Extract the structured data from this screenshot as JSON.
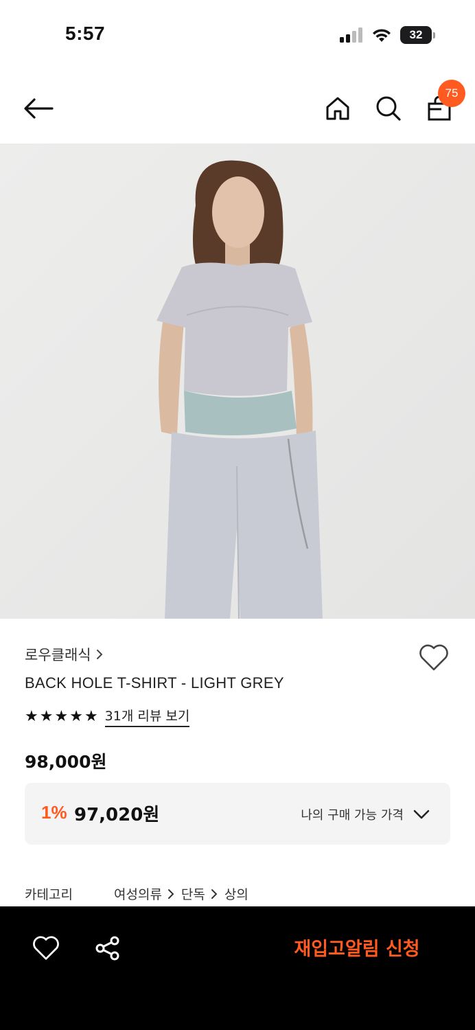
{
  "status_bar": {
    "time": "5:57",
    "battery": "32"
  },
  "header": {
    "cart_count": "75"
  },
  "product": {
    "brand": "로우클래식",
    "name": "BACK HOLE T-SHIRT - LIGHT GREY",
    "rating_stars": 5,
    "review_link": "31개 리뷰 보기",
    "price": "98,000원",
    "discount_rate": "1%",
    "discount_price": "97,020원",
    "my_price_label": "나의 구매 가능 가격"
  },
  "category": {
    "label": "카테고리",
    "crumbs": [
      "여성의류",
      "단독",
      "상의"
    ]
  },
  "bottom_bar": {
    "restock_label": "재입고알림 신청"
  },
  "colors": {
    "accent": "#ff5a1f",
    "bottom_bar": "#000000",
    "price_box": "#f4f4f4"
  },
  "icons": [
    "back-arrow-icon",
    "home-icon",
    "search-icon",
    "shopping-bag-icon",
    "heart-icon",
    "share-icon",
    "chevron-down-icon",
    "chevron-right-icon",
    "star-icon"
  ]
}
